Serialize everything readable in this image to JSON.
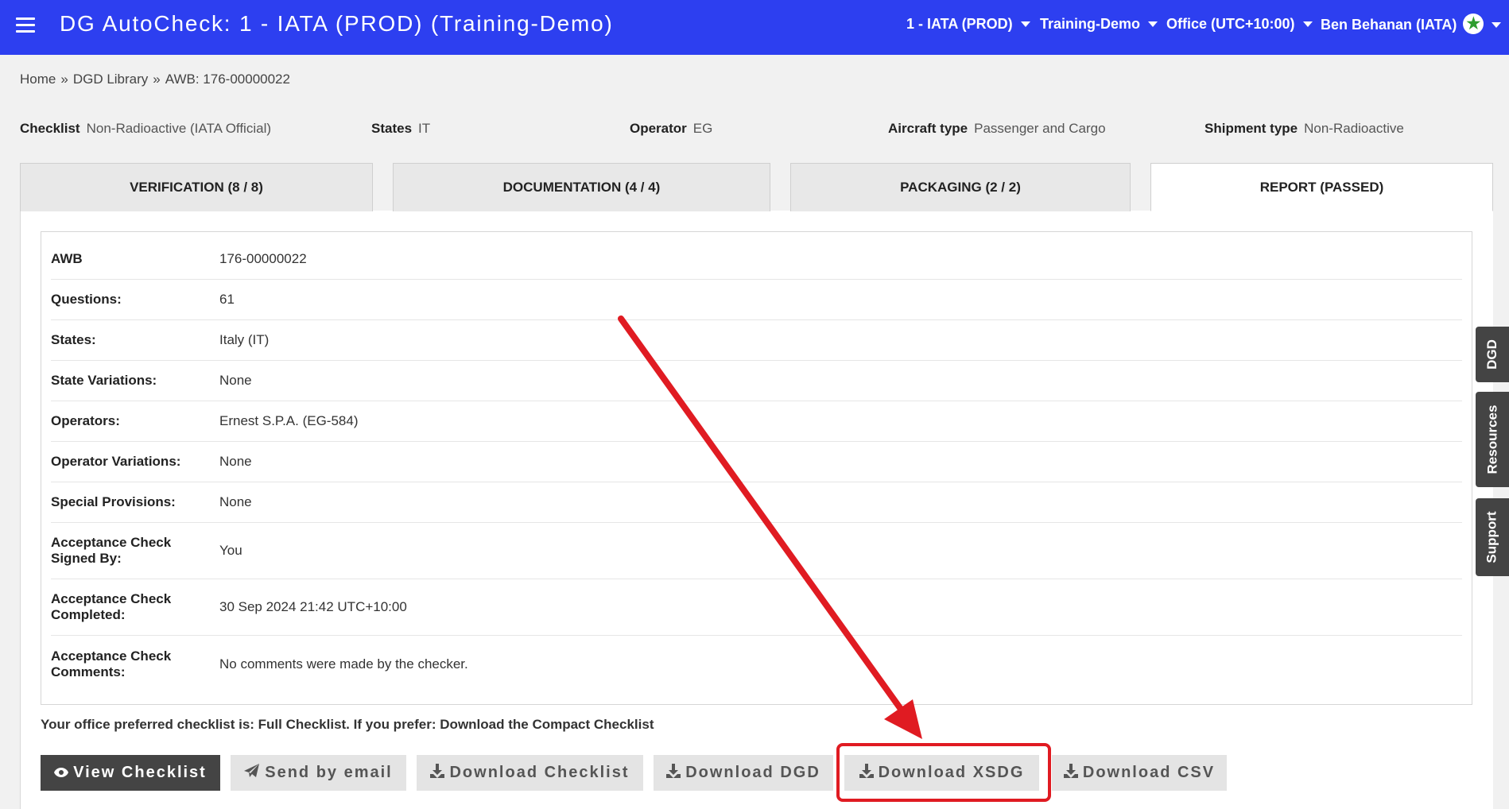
{
  "header": {
    "title": "DG AutoCheck: 1 - IATA (PROD) (Training-Demo)",
    "menus": [
      "1 - IATA (PROD)",
      "Training-Demo",
      "Office (UTC+10:00)",
      "Ben Behanan (IATA)"
    ]
  },
  "breadcrumb": [
    "Home",
    "DGD Library",
    "AWB: 176-00000022"
  ],
  "info": {
    "checklist_label": "Checklist",
    "checklist_value": "Non-Radioactive (IATA Official)",
    "states_label": "States",
    "states_value": "IT",
    "operator_label": "Operator",
    "operator_value": "EG",
    "aircraft_label": "Aircraft type",
    "aircraft_value": "Passenger and Cargo",
    "shipment_label": "Shipment type",
    "shipment_value": "Non-Radioactive"
  },
  "tabs": [
    {
      "label": "VERIFICATION (8 / 8)"
    },
    {
      "label": "DOCUMENTATION (4 / 4)"
    },
    {
      "label": "PACKAGING (2 / 2)"
    },
    {
      "label": "REPORT (PASSED)"
    }
  ],
  "report": [
    {
      "label": "AWB",
      "value": "176-00000022"
    },
    {
      "label": "Questions:",
      "value": "61"
    },
    {
      "label": "States:",
      "value": "Italy (IT)"
    },
    {
      "label": "State Variations:",
      "value": "None"
    },
    {
      "label": "Operators:",
      "value": "Ernest S.P.A. (EG-584)"
    },
    {
      "label": "Operator Variations:",
      "value": "None"
    },
    {
      "label": "Special Provisions:",
      "value": "None"
    },
    {
      "label": "Acceptance Check Signed By:",
      "value": "You"
    },
    {
      "label": "Acceptance Check Completed:",
      "value": "30 Sep 2024 21:42 UTC+10:00"
    },
    {
      "label": "Acceptance Check Comments:",
      "value": "No comments were made by the checker."
    }
  ],
  "preference": {
    "text": "Your office preferred checklist is: Full Checklist. If you prefer:",
    "link": "Download the Compact Checklist"
  },
  "buttons": {
    "view_checklist": "View Checklist",
    "send_email": "Send by email",
    "download_checklist": "Download Checklist",
    "download_dgd": "Download DGD",
    "download_xsdg": "Download XSDG",
    "download_csv": "Download CSV"
  },
  "side_tabs": [
    "DGD",
    "Resources",
    "Support"
  ],
  "icons": {
    "menu": "hamburger-icon",
    "caret": "caret-down-icon",
    "user": "star-icon",
    "view": "eye-icon",
    "send": "paper-plane-icon",
    "download": "download-icon"
  },
  "colors": {
    "header_bg": "#2d3ff0",
    "highlight": "#e01b22",
    "dark_button": "#444444",
    "star": "#2e9d2e"
  }
}
